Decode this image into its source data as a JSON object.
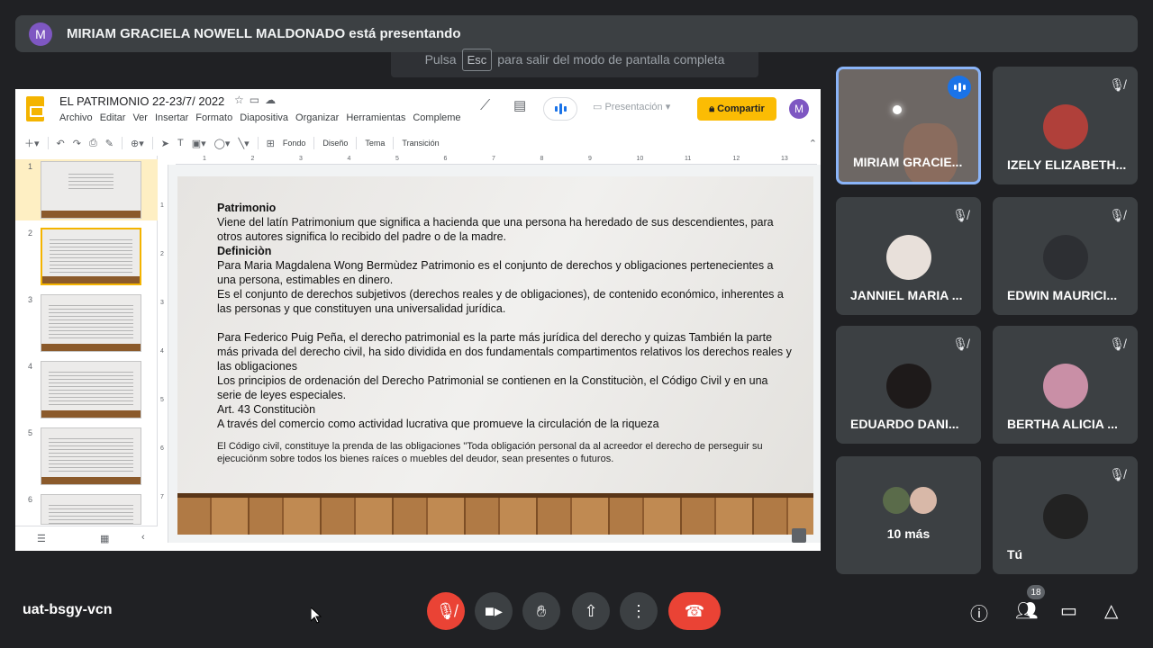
{
  "banner": {
    "avatar_letter": "M",
    "text": "MIRIAM GRACIELA NOWELL MALDONADO está presentando"
  },
  "escbar": {
    "prefix": "Pulsa",
    "key": "Esc",
    "suffix": "para salir del modo de pantalla completa"
  },
  "slides_app": {
    "title": "EL PATRIMONIO  22-23/7/ 2022",
    "menu": [
      "Archivo",
      "Editar",
      "Ver",
      "Insertar",
      "Formato",
      "Diapositiva",
      "Organizar",
      "Herramientas",
      "Compleme"
    ],
    "present_label": "Presentación",
    "share_label": "Compartir",
    "user_initial": "M",
    "toolbar": {
      "background": "Fondo",
      "layout": "Diseño",
      "theme": "Tema",
      "transition": "Transición"
    },
    "ruler_ticks": [
      "1",
      "2",
      "3",
      "4",
      "5",
      "6",
      "7",
      "8",
      "9",
      "10",
      "11",
      "12",
      "13"
    ],
    "vruler_ticks": [
      "1",
      "2",
      "3",
      "4",
      "5",
      "6",
      "7"
    ],
    "thumb_numbers": [
      "1",
      "2",
      "3",
      "4",
      "5",
      "6"
    ],
    "slide": {
      "heading1": "Patrimonio",
      "para1": "Viene del latín Patrimonium  que significa a hacienda que una persona ha heredado de sus descendientes, para otros autores significa lo  recibido del padre o de la madre.",
      "heading2": "Definiciòn",
      "para2": "Para Maria Magdalena Wong Bermùdez  Patrimonio es el conjunto de derechos y obligaciones pertenecientes a una persona, estimables en dinero.",
      "para3": " Es el conjunto de derechos subjetivos (derechos reales y de obligaciones), de contenido económico, inherentes a las personas y que constituyen una universalidad jurídica.",
      "para4": "Para Federico Puig Peña,  el derecho patrimonial es la parte más jurídica del derecho y quizas También la parte más privada del derecho civil, ha sido dividida en dos fundamentals compartimentos  relativos los derechos reales y las obligaciones",
      "para5": "Los principios de ordenación  del Derecho Patrimonial se contienen en la Constituciòn, el Código Civil y en una serie de leyes especiales.",
      "para6": "Art. 43 Constituciòn",
      "para7": "A través del comercio como actividad lucrativa que promueve la circulación de la riqueza",
      "para8": "El Código civil, constituye la prenda de las obligaciones \"Toda obligación personal  da al acreedor el derecho de perseguir su ejecuciónm sobre todos los bienes  raíces o muebles del deudor, sean presentes o futuros."
    }
  },
  "participants": [
    {
      "name": "MIRIAM GRACIE...",
      "speaking": true
    },
    {
      "name": "IZELY ELIZABETH...",
      "muted": true
    },
    {
      "name": "JANNIEL MARIA ...",
      "muted": true
    },
    {
      "name": "EDWIN MAURICI...",
      "muted": true
    },
    {
      "name": "EDUARDO DANI...",
      "muted": true
    },
    {
      "name": "BERTHA ALICIA ...",
      "muted": true
    },
    {
      "name": "10 más"
    },
    {
      "name": "Tú",
      "muted": true
    }
  ],
  "meeting_code": "uat-bsgy-vcn",
  "participant_count": "18",
  "colors": {
    "accent": "#8ab4f8",
    "danger": "#ea4335",
    "share": "#fbbc04",
    "bg": "#202124"
  }
}
